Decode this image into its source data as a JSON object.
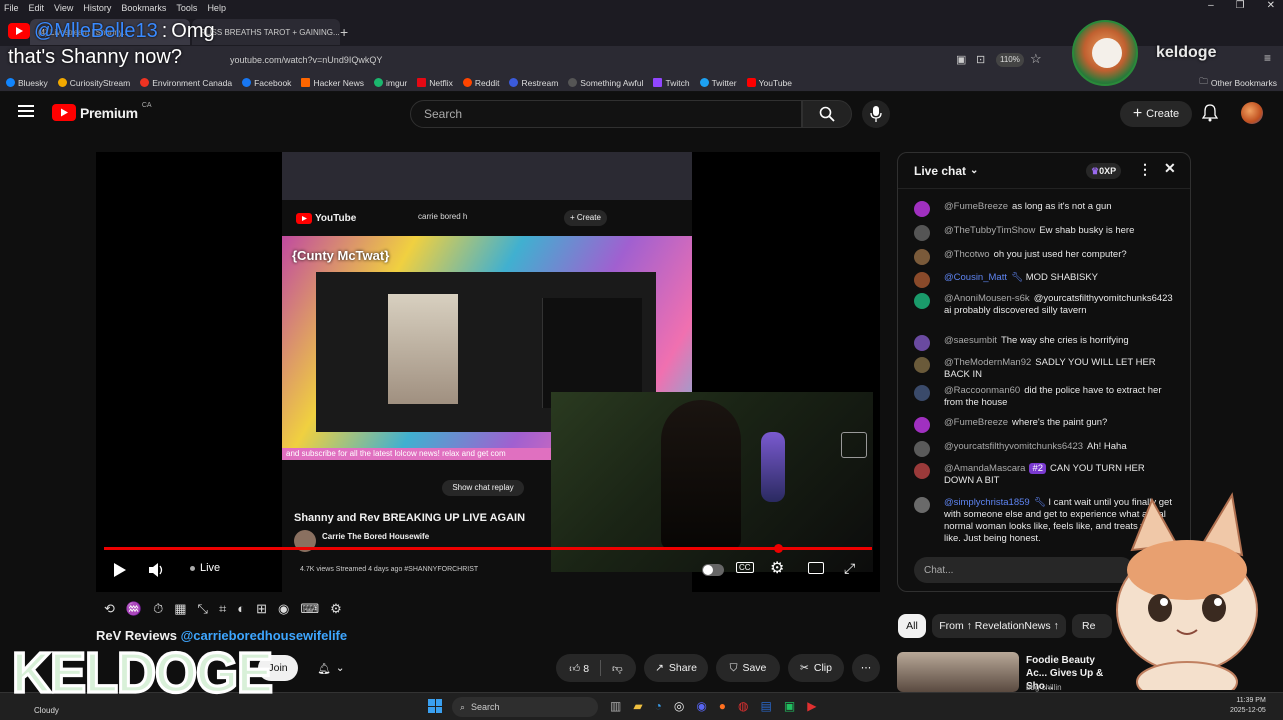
{
  "menubar": [
    "File",
    "Edit",
    "View",
    "History",
    "Bookmarks",
    "Tools",
    "Help"
  ],
  "tabs": [
    {
      "label": "(4) Livestream | Shanny..."
    },
    {
      "label": "RUSS BREATHS TAROT + GAINING..."
    }
  ],
  "url": "youtube.com/watch?v=nUnd9IQwkQY",
  "zoom": "110%",
  "bookmarks": [
    {
      "label": "Bluesky",
      "color": "#1185fe"
    },
    {
      "label": "CuriosityStream",
      "color": "#f2a900"
    },
    {
      "label": "Environment Canada",
      "color": "#e32"
    },
    {
      "label": "Facebook",
      "color": "#1877f2"
    },
    {
      "label": "Hacker News",
      "color": "#ff6600"
    },
    {
      "label": "imgur",
      "color": "#1bb76e"
    },
    {
      "label": "Netflix",
      "color": "#e50914"
    },
    {
      "label": "Reddit",
      "color": "#ff4500"
    },
    {
      "label": "Restream",
      "color": "#3b5bdb"
    },
    {
      "label": "Something Awful",
      "color": "#222"
    },
    {
      "label": "Twitch",
      "color": "#9146ff"
    },
    {
      "label": "Twitter",
      "color": "#1da1f2"
    },
    {
      "label": "YouTube",
      "color": "#ff0000"
    }
  ],
  "other_bookmarks": "Other Bookmarks",
  "overlay": {
    "chat_user": "@MlleBelle13",
    "chat_msg1": "Omg",
    "chat_msg2": "that's Shanny now?",
    "streamer_name": "keldoge",
    "logo_text": "KELDOGE"
  },
  "yt": {
    "logo": "Premium",
    "region": "CA",
    "search_placeholder": "Search",
    "create": "Create"
  },
  "video": {
    "inner_title": "Shanny and Rev BREAKING UP LIVE AGAIN",
    "inner_channel": "Carrie The Bored Housewife",
    "inner_views": "4.7K views  Streamed 4 days ago  #SHANNYFORCHRIST",
    "inner_banner": "{Cunty McTwat}",
    "inner_ticker": "and subscribe for all the latest lolcow news! relax and get com",
    "inner_show_chat": "Show chat replay",
    "inner_search": "carrie bored h",
    "live_label": "Live"
  },
  "chat": {
    "title": "Live chat",
    "points": "0XP",
    "input_placeholder": "Chat...",
    "messages": [
      {
        "author": "@FumeBreeze",
        "text": "as long as it's not a gun",
        "color": "#a030c0",
        "mod": false
      },
      {
        "author": "@TheTubbyTimShow",
        "text": "Ew shab busky is here",
        "color": "#555",
        "mod": false
      },
      {
        "author": "@Thcotwo",
        "text": "oh you just used her computer?",
        "color": "#7a5a3a",
        "mod": false
      },
      {
        "author": "@Cousin_Matt",
        "text": "MOD SHABISKY",
        "color": "#8a4a2a",
        "mod": true
      },
      {
        "author": "@AnoniMousen-s6k",
        "text": "@yourcatsfilthyvomitchunks6423 ai probably discovered silly tavern",
        "color": "#1a9a6a",
        "mod": false
      },
      {
        "author": "@saesumbit",
        "text": "The way she cries is horrifying",
        "color": "#6a4aa0",
        "mod": false
      },
      {
        "author": "@TheModernMan92",
        "text": "SADLY YOU WILL LET HER BACK IN",
        "color": "#6a5a3a",
        "mod": false
      },
      {
        "author": "@Raccoonman60",
        "text": "did the police have to extract her from the house",
        "color": "#3a4a6a",
        "mod": false
      },
      {
        "author": "@FumeBreeze",
        "text": "where's the paint gun?",
        "color": "#a030c0",
        "mod": false
      },
      {
        "author": "@yourcatsfilthyvomitchunks6423",
        "text": "Ah! Haha",
        "color": "#5a5a5a",
        "mod": false
      },
      {
        "author": "@AmandaMascara",
        "text": "CAN YOU TURN HER DOWN A BIT",
        "color": "#9a3a3a",
        "mod": false,
        "badge": "#2"
      },
      {
        "author": "@simplychrista1859",
        "text": "I cant wait until you finally get with someone else and get to experience what a real normal woman looks like, feels like, and treats you like. Just being honest.",
        "color": "#6a6a6a",
        "mod": true
      }
    ]
  },
  "below": {
    "title_prefix": "ReV Reviews",
    "title_link": "@carrieboredhousewifelife",
    "join": "Join",
    "likes": "8",
    "share": "Share",
    "save": "Save",
    "clip": "Clip"
  },
  "filters": [
    "All",
    "From ↑ RevelationNews ↑",
    "Re"
  ],
  "rec": {
    "title": "Foodie Beauty Ac... Gives Up & Sho...",
    "channel": "bbg chillin"
  },
  "taskbar": {
    "weather": "Cloudy",
    "search": "Search",
    "time": "11:39 PM",
    "date": "2025-12-05"
  },
  "colors": {
    "yt_red": "#ff0000",
    "accent_blue": "#3ea6ff",
    "mod_blue": "#5e84f1",
    "chat_badge_purple": "#7a3ad0"
  }
}
